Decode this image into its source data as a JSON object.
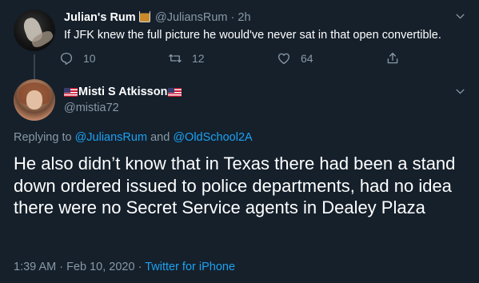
{
  "parent_tweet": {
    "display_name": "Julian's Rum",
    "handle": "@JuliansRum",
    "separator": "·",
    "time_ago": "2h",
    "text": "If JFK knew the full picture he would've never sat in that open convertible.",
    "reply_count": "10",
    "retweet_count": "12",
    "like_count": "64"
  },
  "main_tweet": {
    "display_name": "Misti S Atkisson",
    "handle": "@mistia72",
    "replying_prefix": "Replying to",
    "replying_user1": "@JuliansRum",
    "replying_and": "and",
    "replying_user2": "@OldSchool2A",
    "text": "He also didn’t know that in Texas there had been a stand down ordered issued to police departments, had no idea there were no Secret Service agents in Dealey Plaza",
    "timestamp": "1:39 AM · Feb 10, 2020",
    "separator": "·",
    "source": "Twitter for iPhone"
  },
  "icons": {
    "avatar": "avatar-image",
    "glass": "tumbler-glass-icon",
    "flag": "us-flag-icon",
    "more": "chevron-down-icon",
    "reply": "reply-icon",
    "retweet": "retweet-icon",
    "like": "heart-icon",
    "share": "share-icon"
  },
  "colors": {
    "background": "#15202b",
    "text": "#ffffff",
    "muted": "#8899a6",
    "link": "#1da1f2"
  }
}
